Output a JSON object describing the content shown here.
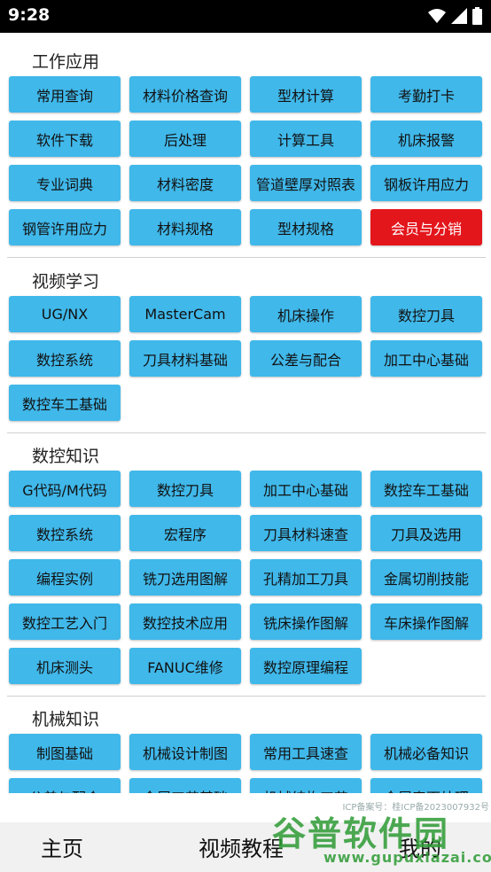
{
  "status": {
    "time": "9:28"
  },
  "sections": [
    {
      "title": "工作应用",
      "items": [
        "常用查询",
        "材料价格查询",
        "型材计算",
        "考勤打卡",
        "软件下载",
        "后处理",
        "计算工具",
        "机床报警",
        "专业词典",
        "材料密度",
        "管道壁厚对照表",
        "钢板许用应力",
        "钢管许用应力",
        "材料规格",
        "型材规格",
        "会员与分销"
      ]
    },
    {
      "title": "视频学习",
      "items": [
        "UG/NX",
        "MasterCam",
        "机床操作",
        "数控刀具",
        "数控系统",
        "刀具材料基础",
        "公差与配合",
        "加工中心基础",
        "数控车工基础"
      ]
    },
    {
      "title": "数控知识",
      "items": [
        "G代码/M代码",
        "数控刀具",
        "加工中心基础",
        "数控车工基础",
        "数控系统",
        "宏程序",
        "刀具材料速查",
        "刀具及选用",
        "编程实例",
        "铣刀选用图解",
        "孔精加工刀具",
        "金属切削技能",
        "数控工艺入门",
        "数控技术应用",
        "铣床操作图解",
        "车床操作图解",
        "机床测头",
        "FANUC维修",
        "数控原理编程"
      ]
    },
    {
      "title": "机械知识",
      "items": [
        "制图基础",
        "机械设计制图",
        "常用工具速查",
        "机械必备知识",
        "公差与配合",
        "金属工艺基础",
        "机械结构工艺",
        "金属表面处理"
      ]
    }
  ],
  "nav": {
    "home": "主页",
    "video": "视频教程",
    "mine": "我的"
  },
  "watermark": {
    "icp": "ICP备案号：桂ICP备2023007932号",
    "logo": "谷普软件园",
    "url": "www.gupuxlazai.com"
  },
  "colors": {
    "button": "#40b8ea",
    "highlight": "#e3161c"
  }
}
